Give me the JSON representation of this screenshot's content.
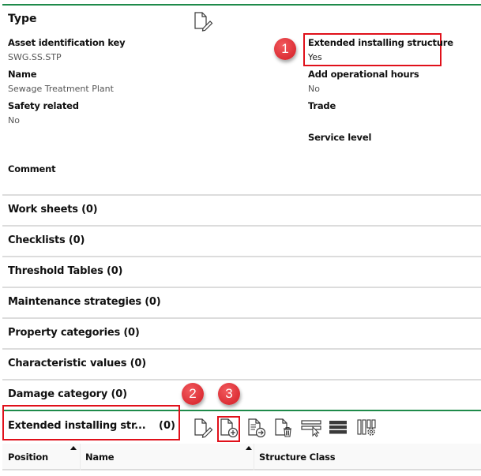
{
  "type_section": {
    "title": "Type",
    "edit_icon": "document-edit-icon",
    "fields_left": [
      {
        "label": "Asset identification key",
        "value": "SWG.SS.STP"
      },
      {
        "label": "Name",
        "value": "Sewage Treatment Plant"
      },
      {
        "label": "Safety related",
        "value": "No"
      },
      {
        "label": "Comment",
        "value": ""
      }
    ],
    "fields_right": [
      {
        "label": "Extended installing structure",
        "value": "Yes"
      },
      {
        "label": "Add operational hours",
        "value": "No"
      },
      {
        "label": "Trade",
        "value": ""
      },
      {
        "label": "Service level",
        "value": ""
      }
    ]
  },
  "sections": [
    {
      "label": "Work sheets (0)"
    },
    {
      "label": "Checklists (0)"
    },
    {
      "label": "Threshold Tables (0)"
    },
    {
      "label": "Maintenance strategies (0)"
    },
    {
      "label": "Property categories (0)"
    },
    {
      "label": "Characteristic values (0)"
    },
    {
      "label": "Damage category (0)"
    }
  ],
  "extended_panel": {
    "title": "Extended installing str...",
    "count": "(0)",
    "toolbar": [
      {
        "icon": "document-edit-icon",
        "action": "edit"
      },
      {
        "icon": "document-add-icon",
        "action": "add"
      },
      {
        "icon": "document-export-icon",
        "action": "open"
      },
      {
        "icon": "document-delete-icon",
        "action": "delete"
      },
      {
        "icon": "row-select-icon",
        "action": "select"
      },
      {
        "icon": "list-view-icon",
        "action": "list"
      },
      {
        "icon": "column-settings-icon",
        "action": "column settings"
      }
    ],
    "columns": [
      {
        "label": "Position",
        "sort": "ascending"
      },
      {
        "label": "Name",
        "sort": "ascending"
      },
      {
        "label": "Structure Class",
        "sort": ""
      }
    ],
    "rows": []
  },
  "annotations": [
    {
      "number": "1",
      "target": "Extended installing structure field"
    },
    {
      "number": "2",
      "target": "Extended installing structure panel header"
    },
    {
      "number": "3",
      "target": "Add new document button"
    }
  ],
  "colors": {
    "accent_green": "#1e8a4a",
    "highlight_red": "#e0101a",
    "badge_red": "#dc2e35"
  }
}
